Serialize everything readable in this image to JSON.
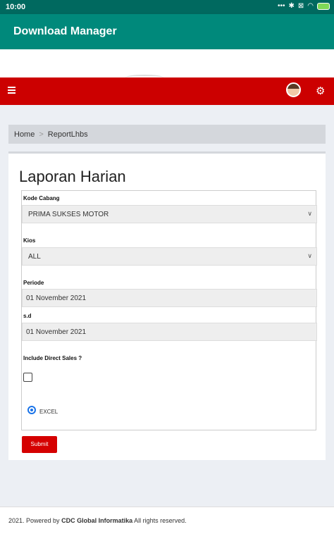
{
  "status_bar": {
    "time": "10:00"
  },
  "app_bar": {
    "title": "Download Manager"
  },
  "breadcrumb": {
    "home": "Home",
    "separator": ">",
    "current": "ReportLhbs"
  },
  "page": {
    "title": "Laporan Harian"
  },
  "form": {
    "kode_cabang_label": "Kode Cabang",
    "kode_cabang_value": "PRIMA SUKSES MOTOR",
    "kios_label": "Kios",
    "kios_value": "ALL",
    "periode_label": "Periode",
    "periode_start": "01 November 2021",
    "sd_label": "s.d",
    "periode_end": "01 November 2021",
    "direct_sales_label": "Include Direct Sales ?",
    "direct_sales_checked": false,
    "export_option": "EXCEL",
    "submit_label": "Submit"
  },
  "footer": {
    "prefix": "2021. Powered by",
    "company": "CDC Global Informatika",
    "suffix": "All rights reserved."
  },
  "colors": {
    "app_bar": "#00897b",
    "status_bar": "#00695f",
    "nav": "#cc0000",
    "submit": "#d50000"
  }
}
